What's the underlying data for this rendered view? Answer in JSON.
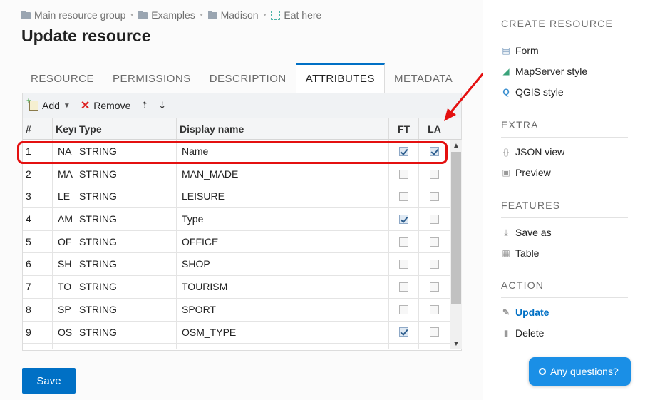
{
  "breadcrumb": [
    {
      "label": "Main resource group",
      "icon": "folder-icon"
    },
    {
      "label": "Examples",
      "icon": "folder-icon"
    },
    {
      "label": "Madison",
      "icon": "folder-icon"
    },
    {
      "label": "Eat here",
      "icon": "vector-layer-icon"
    }
  ],
  "page_title": "Update resource",
  "tabs": [
    "RESOURCE",
    "PERMISSIONS",
    "DESCRIPTION",
    "ATTRIBUTES",
    "METADATA"
  ],
  "active_tab": "ATTRIBUTES",
  "toolbar": {
    "add_label": "Add",
    "remove_label": "Remove",
    "move_up": "⇡",
    "move_down": "⇣"
  },
  "table": {
    "columns": [
      "#",
      "Keyname",
      "Type",
      "Display name",
      "FT",
      "LA"
    ],
    "rows": [
      {
        "num": "1",
        "key": "NA",
        "type": "STRING",
        "display": "Name",
        "ft": true,
        "la": true
      },
      {
        "num": "2",
        "key": "MA",
        "type": "STRING",
        "display": "MAN_MADE",
        "ft": false,
        "la": false
      },
      {
        "num": "3",
        "key": "LE",
        "type": "STRING",
        "display": "LEISURE",
        "ft": false,
        "la": false
      },
      {
        "num": "4",
        "key": "AM",
        "type": "STRING",
        "display": "Type",
        "ft": true,
        "la": false
      },
      {
        "num": "5",
        "key": "OF",
        "type": "STRING",
        "display": "OFFICE",
        "ft": false,
        "la": false
      },
      {
        "num": "6",
        "key": "SH",
        "type": "STRING",
        "display": "SHOP",
        "ft": false,
        "la": false
      },
      {
        "num": "7",
        "key": "TO",
        "type": "STRING",
        "display": "TOURISM",
        "ft": false,
        "la": false
      },
      {
        "num": "8",
        "key": "SP",
        "type": "STRING",
        "display": "SPORT",
        "ft": false,
        "la": false
      },
      {
        "num": "9",
        "key": "OS",
        "type": "STRING",
        "display": "OSM_TYPE",
        "ft": true,
        "la": false
      },
      {
        "num": "",
        "key": "",
        "type": "",
        "display": "",
        "ft": false,
        "la": false
      }
    ]
  },
  "save_label": "Save",
  "sidebar": {
    "create_head": "CREATE RESOURCE",
    "create_items": [
      {
        "label": "Form",
        "icon": "form-icon"
      },
      {
        "label": "MapServer style",
        "icon": "mapserver-style-icon"
      },
      {
        "label": "QGIS style",
        "icon": "qgis-style-icon"
      }
    ],
    "extra_head": "EXTRA",
    "extra_items": [
      {
        "label": "JSON view",
        "icon": "json-icon"
      },
      {
        "label": "Preview",
        "icon": "preview-icon"
      }
    ],
    "features_head": "FEATURES",
    "features_items": [
      {
        "label": "Save as",
        "icon": "download-icon"
      },
      {
        "label": "Table",
        "icon": "table-icon"
      }
    ],
    "action_head": "ACTION",
    "action_items": [
      {
        "label": "Update",
        "icon": "pencil-icon"
      },
      {
        "label": "Delete",
        "icon": "trash-icon"
      }
    ]
  },
  "help_label": "Any questions?",
  "colors": {
    "accent": "#0070c5",
    "annotation": "#e41010",
    "help_button": "#1a8fe6"
  }
}
